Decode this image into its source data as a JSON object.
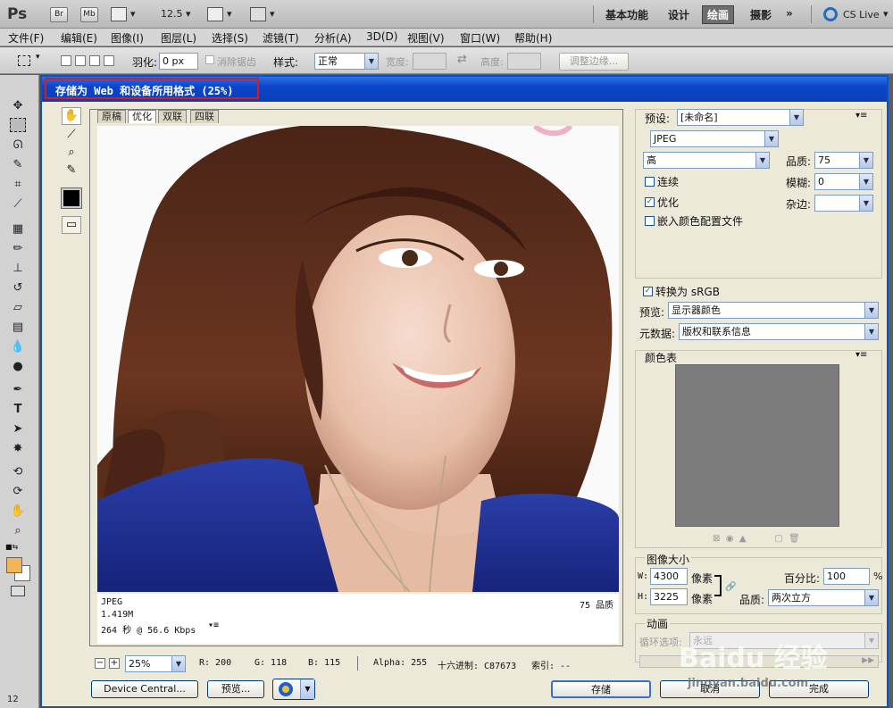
{
  "app": {
    "logo": "Ps",
    "app_buttons": [
      "Br",
      "Mb"
    ],
    "zoom_value": "12.5",
    "workspaces": [
      "基本功能",
      "设计",
      "绘画",
      "摄影"
    ],
    "active_workspace": "绘画",
    "more_label": "»",
    "cs_live": "CS Live"
  },
  "menubar": [
    "文件(F)",
    "编辑(E)",
    "图像(I)",
    "图层(L)",
    "选择(S)",
    "滤镜(T)",
    "分析(A)",
    "3D(D)",
    "视图(V)",
    "窗口(W)",
    "帮助(H)"
  ],
  "options": {
    "feather_label": "羽化:",
    "feather_value": "0 px",
    "antialias_label": "消除锯齿",
    "style_label": "样式:",
    "style_value": "正常",
    "width_label": "宽度:",
    "height_label": "高度:",
    "refine_edge_label": "调整边缘..."
  },
  "dialog": {
    "title": "存储为 Web 和设备所用格式 (25%)",
    "tabs": [
      "原稿",
      "优化",
      "双联",
      "四联"
    ],
    "active_tab": "优化",
    "info": {
      "format": "JPEG",
      "size": "1.419M",
      "time": "264 秒 @ 56.6 Kbps",
      "quality_text": "75 品质"
    },
    "status": {
      "zoom": "25%",
      "r": "R: 200",
      "g": "G: 118",
      "b": "B: 115",
      "alpha": "Alpha: 255",
      "hex": "十六进制: C87673",
      "index": "索引: --"
    },
    "buttons": {
      "device_central": "Device Central...",
      "preview": "预览...",
      "save": "存储",
      "cancel": "取消",
      "done": "完成"
    },
    "settings": {
      "preset_label": "预设:",
      "preset_value": "[未命名]",
      "format_value": "JPEG",
      "quality_level": "高",
      "quality_label": "品质:",
      "quality_value": "75",
      "progressive_label": "连续",
      "blur_label": "模糊:",
      "blur_value": "0",
      "optimized_label": "优化",
      "matte_label": "杂边:",
      "matte_value": "",
      "embed_profile_label": "嵌入颜色配置文件",
      "convert_srgb_label": "转换为 sRGB",
      "preview_label": "预览:",
      "preview_value": "显示器颜色",
      "metadata_label": "元数据:",
      "metadata_value": "版权和联系信息",
      "color_table_label": "颜色表",
      "image_size_label": "图像大小",
      "w_label": "W:",
      "w_value": "4300",
      "h_label": "H:",
      "h_value": "3225",
      "px_unit": "像素",
      "percent_label": "百分比:",
      "percent_value": "100",
      "percent_unit": "%",
      "resample_label": "品质:",
      "resample_value": "两次立方",
      "animation_label": "动画",
      "loop_label": "循环选项:",
      "loop_value": "永远"
    }
  },
  "watermark": {
    "brand": "Baidu 经验",
    "url": "jingyan.baidu.com"
  },
  "colors": {
    "accent_blue": "#0a53c4",
    "title_highlight": "#e01818",
    "pixel_sample": "#C87673"
  }
}
